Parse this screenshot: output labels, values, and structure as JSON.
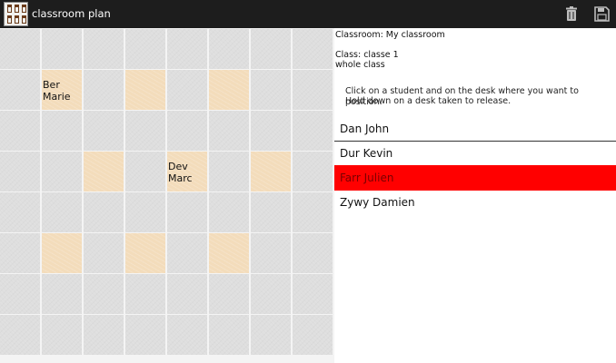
{
  "app": {
    "title": "classroom plan",
    "icon": "classroom-chairs-icon",
    "actions": [
      {
        "name": "delete",
        "icon": "trash-icon"
      },
      {
        "name": "save",
        "icon": "save-icon"
      }
    ]
  },
  "info": {
    "classroom": "Classroom: My classroom",
    "class": "Class: classe 1",
    "group": "whole class",
    "instructions_line1": "Click on a student and on the desk where you want to position.",
    "instructions_line2": "Hold down on a desk taken to release."
  },
  "students": [
    {
      "name": "Dan John",
      "selected": false
    },
    {
      "name": "Dur Kevin",
      "selected": false
    },
    {
      "name": "Farr Julien",
      "selected": true
    },
    {
      "name": "Zywy Damien",
      "selected": false
    }
  ],
  "seats": {
    "ber_marie": {
      "line1": "Ber",
      "line2": "Marie"
    },
    "dev_marc": {
      "line1": "Dev",
      "line2": "Marc"
    }
  },
  "colors": {
    "actionbar": "#1d1d1d",
    "desk": "#f3dcbb",
    "empty_cell": "#dedede",
    "selected_student": "#ff0000"
  }
}
